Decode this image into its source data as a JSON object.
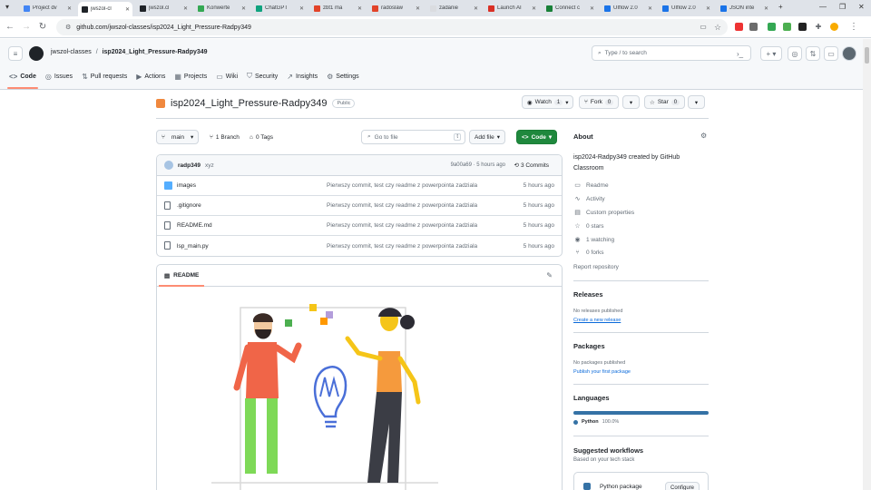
{
  "browser": {
    "tabs": [
      {
        "label": "Project dv",
        "color": "#4285f4"
      },
      {
        "label": "jwszol-cl",
        "color": "#1f2328",
        "active": true
      },
      {
        "label": "jwszol.cl",
        "color": "#1f2328"
      },
      {
        "label": "Konwerte",
        "color": "#34a853"
      },
      {
        "label": "ChatGPT",
        "color": "#10a37f"
      },
      {
        "label": "zbt1 ma",
        "color": "#e24329"
      },
      {
        "label": "radoslaw",
        "color": "#e24329"
      },
      {
        "label": "zadanie",
        "color": "#dadce0"
      },
      {
        "label": "Launch AI",
        "color": "#d93025"
      },
      {
        "label": "Connect c",
        "color": "#188038"
      },
      {
        "label": "UIflow 2.0",
        "color": "#1a73e8"
      },
      {
        "label": "UIflow 2.0",
        "color": "#1a73e8"
      },
      {
        "label": "JSON inte",
        "color": "#1a73e8"
      }
    ],
    "new_tab": "+",
    "url": "github.com/jwszol-classes/isp2024_Light_Pressure-Radpy349"
  },
  "github": {
    "org": "jwszol-classes",
    "separator": "/",
    "repo": "isp2024_Light_Pressure-Radpy349",
    "search_placeholder": "Type / to search",
    "nav": [
      {
        "label": "Code",
        "icon": "<>",
        "active": true
      },
      {
        "label": "Issues",
        "icon": "◎"
      },
      {
        "label": "Pull requests",
        "icon": "⇅"
      },
      {
        "label": "Actions",
        "icon": "▶"
      },
      {
        "label": "Projects",
        "icon": "▦"
      },
      {
        "label": "Wiki",
        "icon": "▭"
      },
      {
        "label": "Security",
        "icon": "⛉"
      },
      {
        "label": "Insights",
        "icon": "↗"
      },
      {
        "label": "Settings",
        "icon": "⚙"
      }
    ]
  },
  "repo": {
    "title": "isp2024_Light_Pressure-Radpy349",
    "visibility": "Public",
    "watch_label": "Watch",
    "watch_count": "1",
    "fork_label": "Fork",
    "fork_count": "0",
    "star_label": "Star",
    "star_count": "0",
    "branch": "main",
    "branches": "1 Branch",
    "tags": "0 Tags",
    "goto_placeholder": "Go to file",
    "goto_key": "t",
    "add_file": "Add file",
    "code_button": "Code"
  },
  "commit": {
    "author": "radp349",
    "message": "xyz",
    "hash_time": "9a00a69 · 5 hours ago",
    "commits": "3 Commits"
  },
  "files": [
    {
      "name": "images",
      "type": "folder",
      "message": "Pierwszy commit, test czy readme z powerpointa zadziala",
      "time": "5 hours ago"
    },
    {
      "name": ".gitignore",
      "type": "file",
      "message": "Pierwszy commit, test czy readme z powerpointa zadziala",
      "time": "5 hours ago"
    },
    {
      "name": "README.md",
      "type": "file",
      "message": "Pierwszy commit, test czy readme z powerpointa zadziala",
      "time": "5 hours ago"
    },
    {
      "name": "lsp_main.py",
      "type": "file",
      "message": "Pierwszy commit, test czy readme z powerpointa zadziala",
      "time": "5 hours ago"
    }
  ],
  "readme": {
    "label": "README"
  },
  "about": {
    "heading": "About",
    "description": "isp2024-Radpy349 created by GitHub Classroom",
    "items": [
      {
        "label": "Readme",
        "icon": "▭"
      },
      {
        "label": "Activity",
        "icon": "∿"
      },
      {
        "label": "Custom properties",
        "icon": "▤"
      },
      {
        "label": "0 stars",
        "icon": "☆"
      },
      {
        "label": "1 watching",
        "icon": "◉"
      },
      {
        "label": "0 forks",
        "icon": "⑂"
      }
    ],
    "report": "Report repository"
  },
  "releases": {
    "heading": "Releases",
    "none": "No releases published",
    "link": "Create a new release"
  },
  "packages": {
    "heading": "Packages",
    "none": "No packages published",
    "link": "Publish your first package"
  },
  "languages": {
    "heading": "Languages",
    "items": [
      {
        "name": "Python",
        "percent": "100.0%",
        "color": "#3572a5",
        "share": 1.0
      }
    ]
  },
  "workflows": {
    "heading": "Suggested workflows",
    "subtitle": "Based on your tech stack",
    "item": "Python package",
    "configure": "Configure"
  }
}
